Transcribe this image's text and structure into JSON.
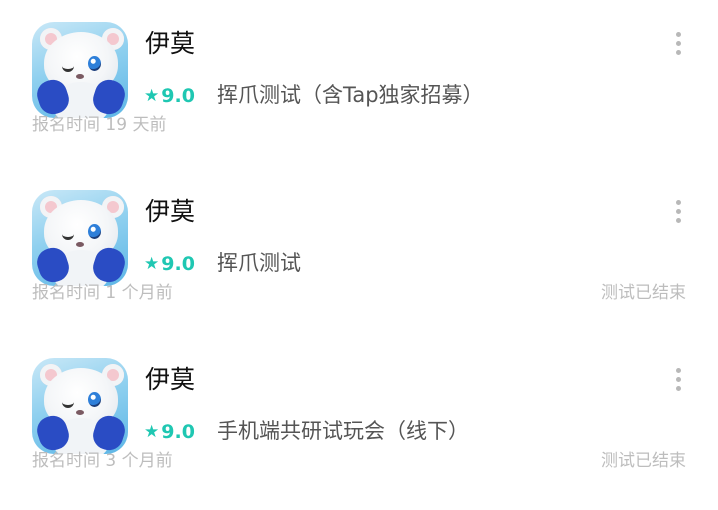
{
  "entries": [
    {
      "app_name": "伊莫",
      "rating": "9.0",
      "test_name": "挥爪测试（含Tap独家招募）",
      "signup_time": "报名时间 19 天前",
      "status": ""
    },
    {
      "app_name": "伊莫",
      "rating": "9.0",
      "test_name": "挥爪测试",
      "signup_time": "报名时间 1 个月前",
      "status": "测试已结束"
    },
    {
      "app_name": "伊莫",
      "rating": "9.0",
      "test_name": "手机端共研试玩会（线下）",
      "signup_time": "报名时间 3 个月前",
      "status": "测试已结束"
    }
  ],
  "icons": {
    "star": "star-icon",
    "more": "more-vertical-icon",
    "app": "polar-bear-app-icon"
  },
  "colors": {
    "accent": "#1fc7b2",
    "muted_text": "#bdbdbd",
    "title_text": "#111111"
  }
}
